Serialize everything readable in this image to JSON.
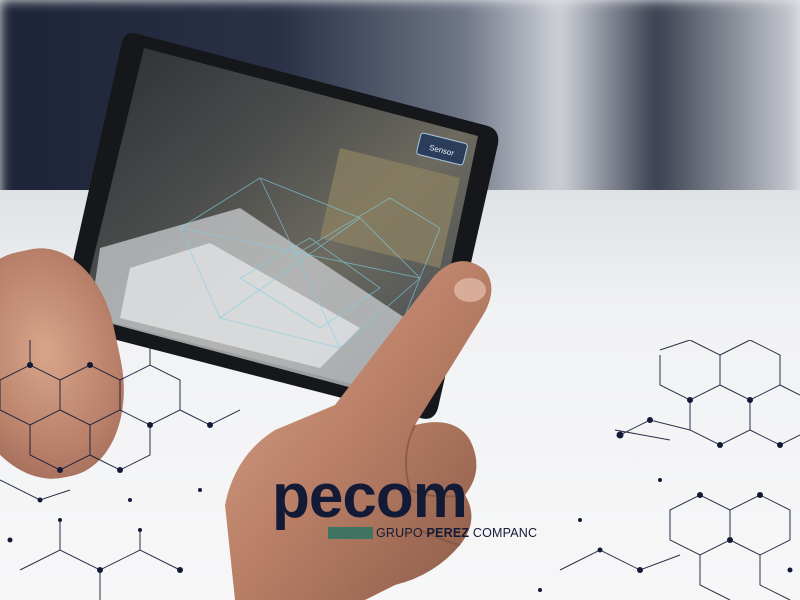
{
  "photo": {
    "subject": "hand-holding-tablet",
    "colors": {
      "navy": "#131a36",
      "green_bar": "#3f7462",
      "skin": "#c28b72"
    }
  },
  "tablet_screen": {
    "button_label": "Sensor"
  },
  "logo": {
    "brand_name": "pecom",
    "subtitle_prefix": "GRUPO ",
    "subtitle_bold": "PEREZ",
    "subtitle_suffix": " COMPANC"
  }
}
